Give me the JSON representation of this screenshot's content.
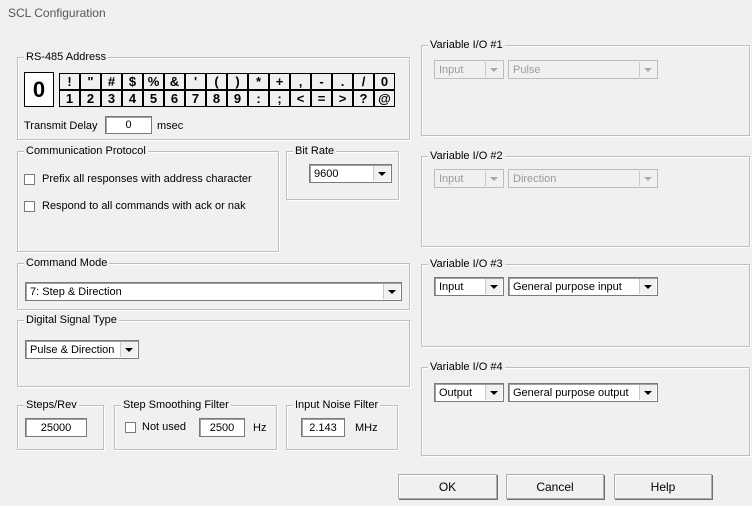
{
  "window_title": "SCL Configuration",
  "rs485": {
    "legend": "RS-485 Address",
    "current": "0",
    "row1": [
      "!",
      "\"",
      "#",
      "$",
      "%",
      "&",
      "'",
      "(",
      ")",
      "*",
      "+",
      ",",
      "-",
      ".",
      "/",
      "0"
    ],
    "row2": [
      "1",
      "2",
      "3",
      "4",
      "5",
      "6",
      "7",
      "8",
      "9",
      ":",
      ";",
      "<",
      "=",
      ">",
      "?",
      "@"
    ],
    "transmit_delay_label": "Transmit Delay",
    "transmit_delay_value": "0",
    "transmit_delay_unit": "msec"
  },
  "comm": {
    "legend": "Communication Protocol",
    "prefix_label": "Prefix all responses with address character",
    "respond_label": "Respond to all commands with ack or nak"
  },
  "bit_rate": {
    "legend": "Bit Rate",
    "value": "9600"
  },
  "command_mode": {
    "legend": "Command Mode",
    "value": "7: Step & Direction"
  },
  "digital_signal": {
    "legend": "Digital Signal Type",
    "value": "Pulse & Direction"
  },
  "steps_rev": {
    "legend": "Steps/Rev",
    "value": "25000"
  },
  "smoothing": {
    "legend": "Step Smoothing Filter",
    "not_used_label": "Not used",
    "value": "2500",
    "unit": "Hz"
  },
  "noise": {
    "legend": "Input Noise Filter",
    "value": "2.143",
    "unit": "MHz"
  },
  "vio": [
    {
      "legend": "Variable I/O #1",
      "dir": "Input",
      "func": "Pulse",
      "enabled": false
    },
    {
      "legend": "Variable I/O #2",
      "dir": "Input",
      "func": "Direction",
      "enabled": false
    },
    {
      "legend": "Variable I/O #3",
      "dir": "Input",
      "func": "General purpose input",
      "enabled": true
    },
    {
      "legend": "Variable I/O #4",
      "dir": "Output",
      "func": "General purpose output",
      "enabled": true
    }
  ],
  "buttons": {
    "ok": "OK",
    "cancel": "Cancel",
    "help": "Help"
  }
}
